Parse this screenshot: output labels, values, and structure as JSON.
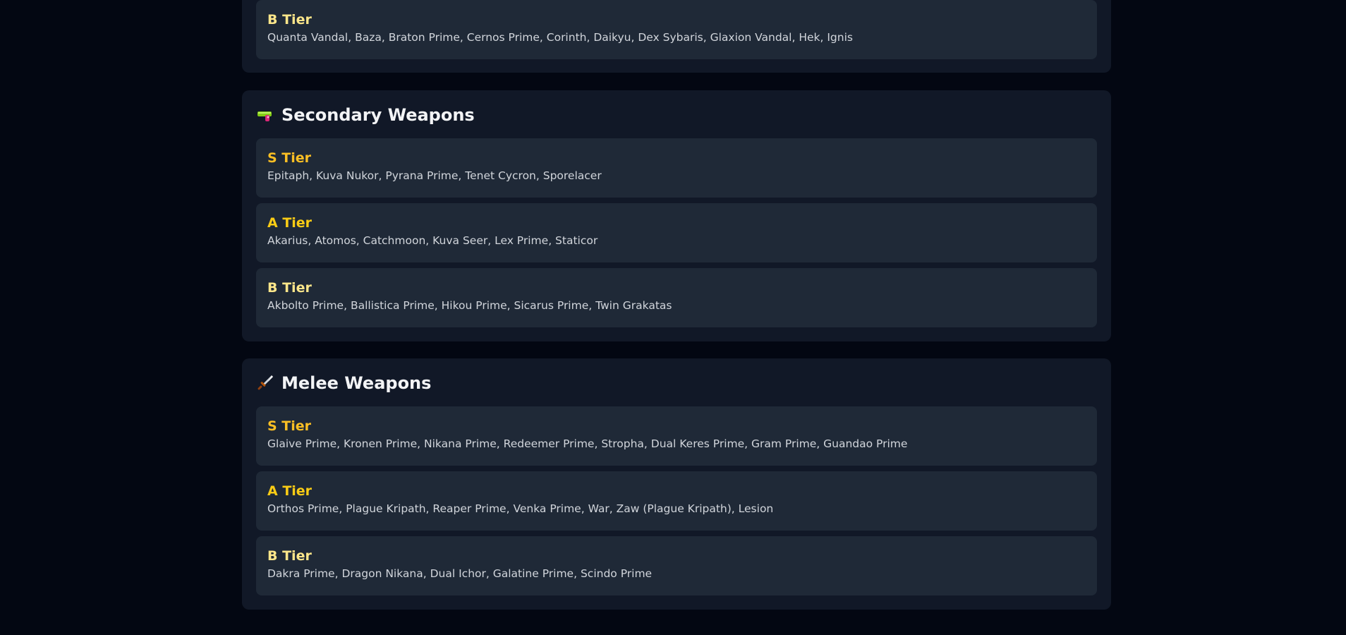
{
  "primary_partial": {
    "tiers": [
      {
        "label": "B Tier",
        "items": "Quanta Vandal, Baza, Braton Prime, Cernos Prime, Corinth, Daikyu, Dex Sybaris, Glaxion Vandal, Hek, Ignis"
      }
    ]
  },
  "secondary": {
    "icon": "water-pistol-icon",
    "title": "Secondary Weapons",
    "tiers": [
      {
        "label": "S Tier",
        "items": "Epitaph, Kuva Nukor, Pyrana Prime, Tenet Cycron, Sporelacer"
      },
      {
        "label": "A Tier",
        "items": "Akarius, Atomos, Catchmoon, Kuva Seer, Lex Prime, Staticor"
      },
      {
        "label": "B Tier",
        "items": "Akbolto Prime, Ballistica Prime, Hikou Prime, Sicarus Prime, Twin Grakatas"
      }
    ]
  },
  "melee": {
    "icon": "dagger-icon",
    "title": "Melee Weapons",
    "tiers": [
      {
        "label": "S Tier",
        "items": "Glaive Prime, Kronen Prime, Nikana Prime, Redeemer Prime, Stropha, Dual Keres Prime, Gram Prime, Guandao Prime"
      },
      {
        "label": "A Tier",
        "items": "Orthos Prime, Plague Kripath, Reaper Prime, Venka Prime, War, Zaw (Plague Kripath), Lesion"
      },
      {
        "label": "B Tier",
        "items": "Dakra Prime, Dragon Nikana, Dual Ichor, Galatine Prime, Scindo Prime"
      }
    ]
  },
  "colors": {
    "background": "#030712",
    "section": "#111827",
    "card": "#1f2937",
    "s_tier": "#fbbf24",
    "a_tier": "#facc15",
    "b_tier": "#fde68a"
  }
}
